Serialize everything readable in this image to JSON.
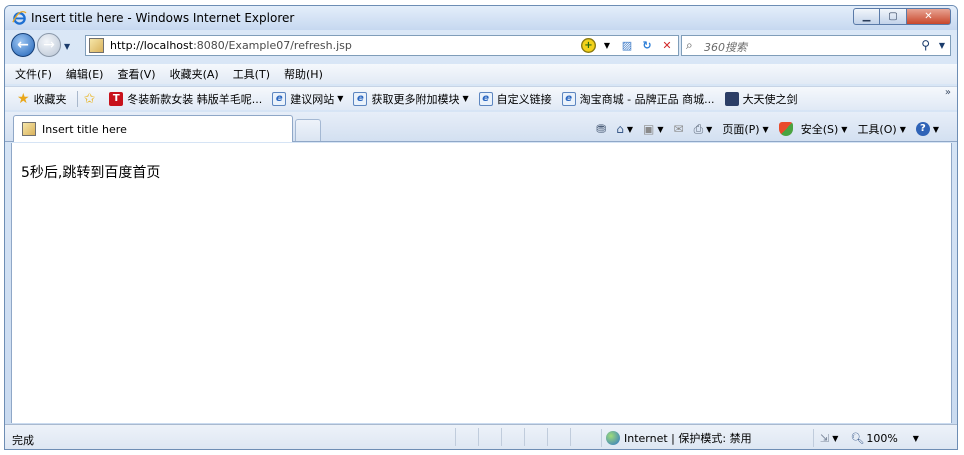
{
  "window": {
    "title": "Insert title here - Windows Internet Explorer",
    "minimize_symbol": "▁",
    "maximize_symbol": "▢",
    "close_symbol": "✕"
  },
  "address_bar": {
    "url_host": "http://localhost",
    "url_rest": ":8080/Example07/refresh.jsp"
  },
  "search": {
    "placeholder": "360搜索"
  },
  "menu": {
    "items": [
      "文件(F)",
      "编辑(E)",
      "查看(V)",
      "收藏夹(A)",
      "工具(T)",
      "帮助(H)"
    ]
  },
  "favorites": {
    "label": "收藏夹",
    "items": [
      {
        "label": "冬装新款女装 韩版羊毛呢...",
        "icon": "taobao-t-icon"
      },
      {
        "label": "建议网站",
        "icon": "ie-page-icon",
        "dropdown": true
      },
      {
        "label": "获取更多附加模块",
        "icon": "ie-page-icon",
        "dropdown": true
      },
      {
        "label": "自定义链接",
        "icon": "ie-page-icon"
      },
      {
        "label": "淘宝商城 - 品牌正品 商城...",
        "icon": "ie-page-icon"
      },
      {
        "label": "大天使之剑",
        "icon": "game-icon"
      }
    ],
    "more_symbol": "»"
  },
  "tab": {
    "label": "Insert title here"
  },
  "commands": {
    "page": "页面(P)",
    "safety": "安全(S)",
    "tools": "工具(O)"
  },
  "content": {
    "text": "5秒后,跳转到百度首页"
  },
  "status": {
    "text": "完成",
    "zone": "Internet | 保护模式: 禁用",
    "zoom": "100%"
  },
  "colors": {
    "window_frame": "#6d8db4",
    "back_button": "#1f62b7",
    "close_button": "#c8462a"
  }
}
